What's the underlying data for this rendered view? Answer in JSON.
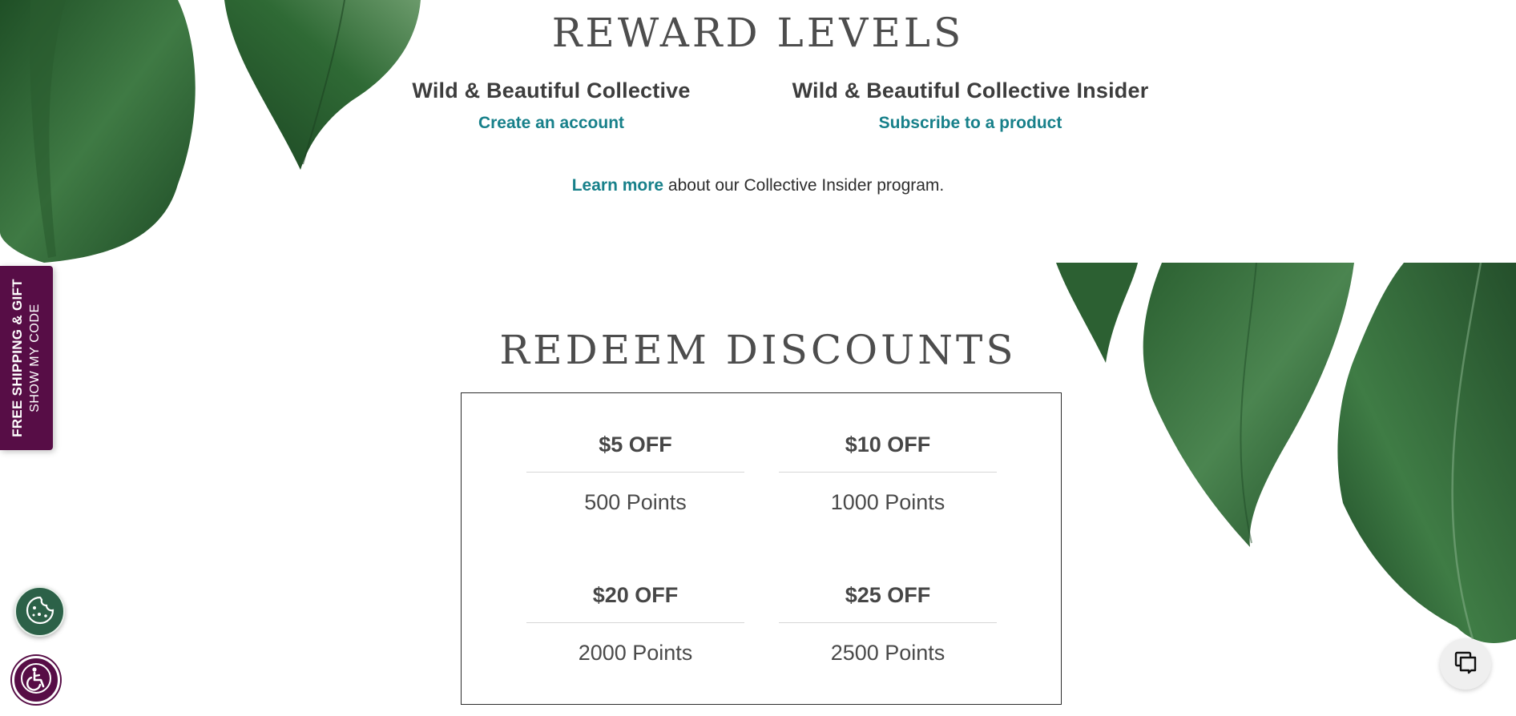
{
  "reward_levels": {
    "title": "REWARD LEVELS",
    "levels": [
      {
        "name": "Wild & Beautiful Collective",
        "action": "Create an account"
      },
      {
        "name": "Wild & Beautiful Collective Insider",
        "action": "Subscribe to a product"
      }
    ],
    "learn_more": {
      "link": "Learn more",
      "text": " about our Collective Insider program."
    }
  },
  "redeem": {
    "title": "REDEEM DISCOUNTS",
    "rewards": [
      {
        "discount": "$5 OFF",
        "points": "500 Points"
      },
      {
        "discount": "$10 OFF",
        "points": "1000 Points"
      },
      {
        "discount": "$20 OFF",
        "points": "2000 Points"
      },
      {
        "discount": "$25 OFF",
        "points": "2500 Points"
      }
    ]
  },
  "promo_tab": {
    "main": "FREE SHIPPING & GIFT",
    "sub": "SHOW MY CODE"
  },
  "floating": {
    "cookie_icon": "cookie-icon",
    "accessibility_icon": "accessibility-icon",
    "chat_icon": "chat-icon"
  },
  "colors": {
    "accent_link": "#17808a",
    "promo_bg": "#570d46",
    "cookie_bg": "#2c6148",
    "leaf_green": "#2f6a35"
  }
}
